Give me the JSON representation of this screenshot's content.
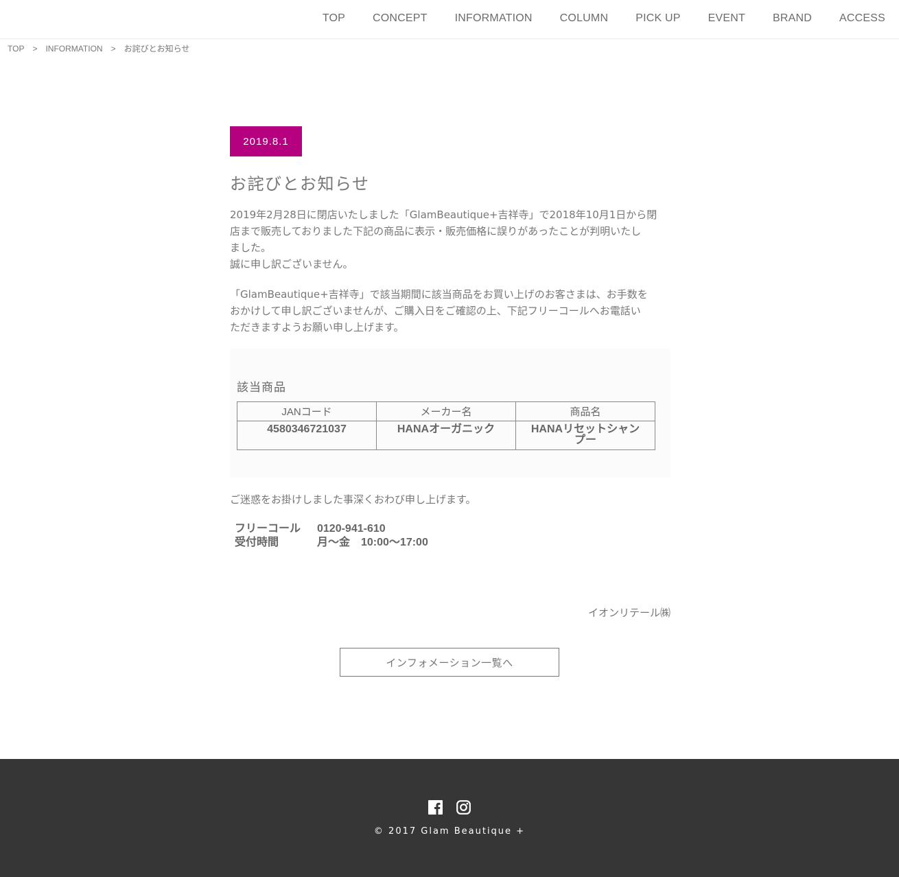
{
  "nav": {
    "items": [
      "TOP",
      "CONCEPT",
      "INFORMATION",
      "COLUMN",
      "PICK UP",
      "EVENT",
      "BRAND",
      "ACCESS"
    ]
  },
  "breadcrumb": {
    "items": [
      "TOP",
      "INFORMATION",
      "お詫びとお知らせ"
    ],
    "separator": ">"
  },
  "article": {
    "date": "2019.8.1",
    "title": "お詫びとお知らせ",
    "para1_lines": [
      "2019年2月28日に閉店いたしました「GlamBeautique+吉祥寺」で2018年10月1日から閉",
      "店まで販売しておりました下記の商品に表示・販売価格に誤りがあったことが判明いたし",
      "ました。",
      "誠に申し訳ございません。"
    ],
    "para2_lines": [
      "「GlamBeautique+吉祥寺」で該当期間に該当商品をお買い上げのお客さまは、お手数を",
      "おかけして申し訳ございませんが、ご購入日をご確認の上、下記フリーコールへお電話い",
      "ただきますようお願い申し上げます。"
    ],
    "product_heading": "該当商品",
    "table": {
      "headers": [
        "JANコード",
        "メーカー名",
        "商品名"
      ],
      "rows": [
        [
          "4580346721037",
          "HANAオーガニック",
          "HANAリセットシャンプー"
        ]
      ],
      "product_name_lines": [
        "HANAリセットシャン",
        "プー"
      ]
    },
    "apology": "ご迷惑をお掛けしました事深くおわび申し上げます。",
    "contact": {
      "freecall_label": "フリーコール",
      "freecall_value": "0120-941-610",
      "hours_label": "受付時間",
      "hours_value": "月〜金　10:00〜17:00"
    },
    "signature": "イオンリテール㈱",
    "back_button": "インフォメーション一覧へ"
  },
  "footer": {
    "icons": [
      "facebook-icon",
      "instagram-icon"
    ],
    "copyright": "© 2017 Glam Beautique +"
  },
  "colors": {
    "accent": "#b5007f",
    "footer_bg": "#363636",
    "text": "#777777"
  }
}
